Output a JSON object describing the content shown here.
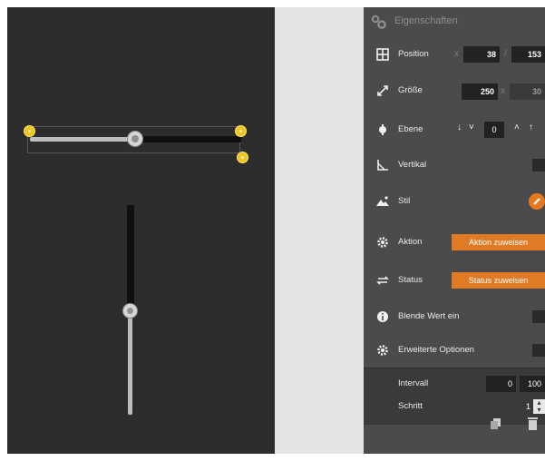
{
  "properties": {
    "title": "Eigenschaften",
    "position": {
      "label": "Position",
      "x": "38",
      "y": "153",
      "x_sep": "x",
      "y_sep": "/"
    },
    "size": {
      "label": "Größe",
      "width": "250",
      "height": "30",
      "sep": "x"
    },
    "layer": {
      "label": "Ebene",
      "value": "0"
    },
    "vertical": {
      "label": "Vertikal"
    },
    "style": {
      "label": "Stil"
    },
    "action": {
      "label": "Aktion",
      "button": "Aktion zuweisen"
    },
    "status": {
      "label": "Status",
      "button": "Status zuweisen"
    },
    "show_value": {
      "label": "Blende Wert ein"
    },
    "advanced": {
      "label": "Erweiterte Optionen"
    },
    "interval": {
      "label": "Intervall",
      "min": "0",
      "max": "100"
    },
    "step": {
      "label": "Schritt",
      "value": "1"
    }
  },
  "colors": {
    "canvas": "#2d2d2d",
    "panel": "#4b4b4b",
    "accent": "#e07a24",
    "handle": "#f0c61d"
  },
  "widgets": {
    "horizontal_slider_level": 0.5,
    "vertical_slider_level": 0.5
  },
  "icons": {
    "panel": "gears-icon",
    "position": "move-icon",
    "size": "resize-icon",
    "layer": "layers-icon",
    "vertical": "angle-icon",
    "style": "paint-icon",
    "action": "gear-icon",
    "status": "refresh-icon",
    "show_value": "info-icon",
    "advanced": "gear-icon",
    "copy": "copy-icon",
    "delete": "trash-icon"
  }
}
